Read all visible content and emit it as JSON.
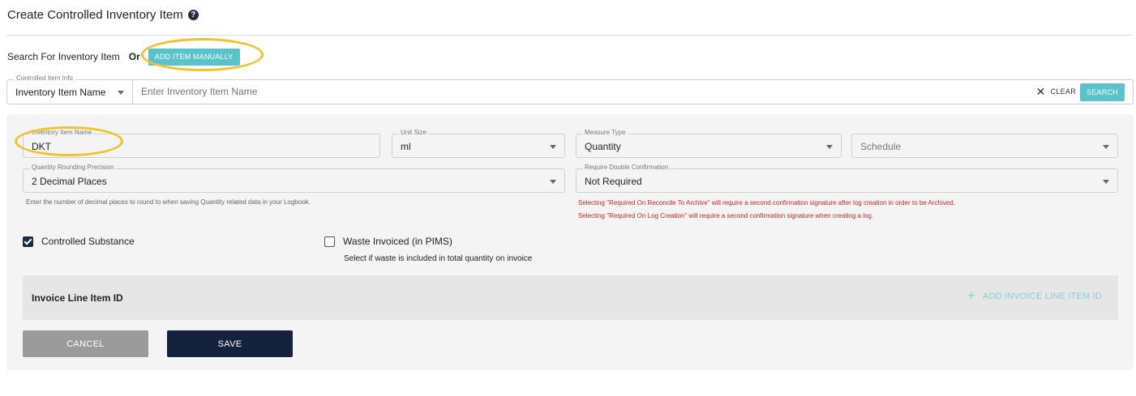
{
  "header": {
    "title": "Create Controlled Inventory Item",
    "help_icon": "?"
  },
  "search": {
    "label": "Search For Inventory Item",
    "or_label": "Or",
    "add_manual_label": "ADD ITEM MANUALLY",
    "legend": "Controlled Item Info",
    "type_value": "Inventory Item Name",
    "placeholder": "Enter Inventory Item Name",
    "clear_label": "CLEAR",
    "search_label": "SEARCH"
  },
  "form": {
    "item_name": {
      "label": "Inventory Item Name",
      "value": "DKT"
    },
    "unit_size": {
      "label": "Unit Size",
      "value": "ml"
    },
    "measure_type": {
      "label": "Measure Type",
      "value": "Quantity"
    },
    "schedule": {
      "placeholder": "Schedule"
    },
    "rounding": {
      "label": "Quantity Rounding Precision",
      "value": "2 Decimal Places",
      "hint": "Enter the number of decimal places to round to when saving Quantity related data in your Logbook."
    },
    "double_confirmation": {
      "label": "Require Double Confirmation",
      "value": "Not Required",
      "warning_1": "Selecting \"Required On Reconcile To Archive\" will require a second confirmation signature after log creation in order to be Archived.",
      "warning_2": "Selecting \"Required On Log Creation\" will require a second confirmation signature when creating a log."
    },
    "controlled_substance": {
      "label": "Controlled Substance",
      "checked": true
    },
    "waste_invoiced": {
      "label": "Waste Invoiced (in PIMS)",
      "checked": false,
      "hint": "Select if waste is included in total quantity on invoice"
    }
  },
  "invoice": {
    "title": "Invoice Line Item ID",
    "add_label": "ADD INVOICE LINE ITEM ID"
  },
  "actions": {
    "cancel_label": "CANCEL",
    "save_label": "SAVE"
  },
  "colors": {
    "accent": "#5ac3c9",
    "primary": "#14223d",
    "highlight": "#f2c12e",
    "warning": "#c0272d"
  }
}
